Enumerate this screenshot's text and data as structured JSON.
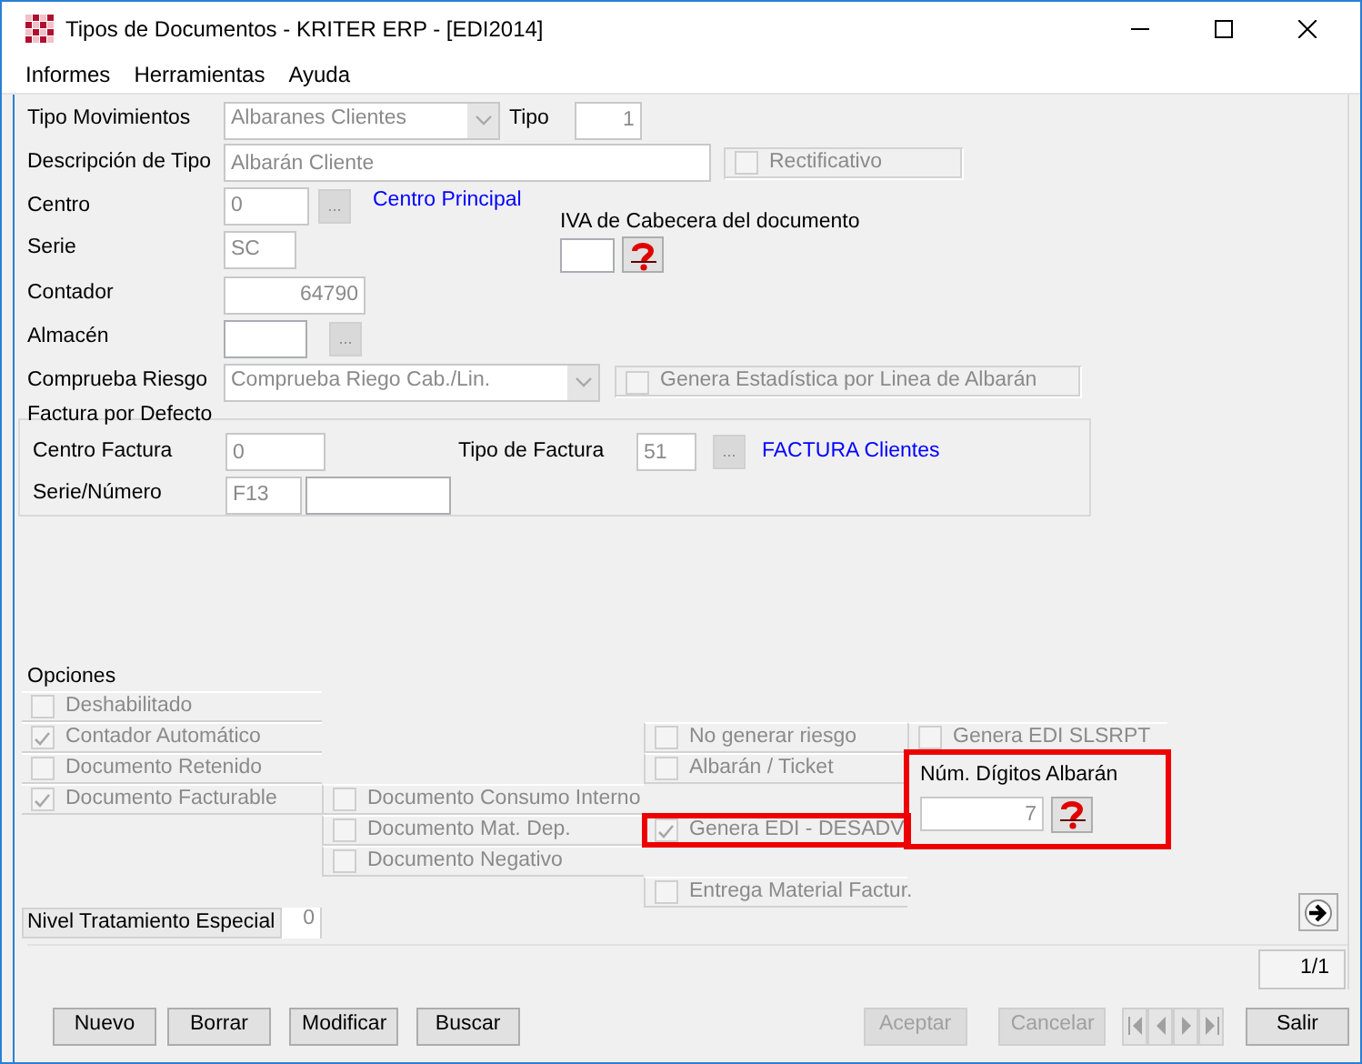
{
  "window": {
    "title": "Tipos de Documentos - KRITER ERP - [EDI2014]"
  },
  "menu": [
    "Informes",
    "Herramientas",
    "Ayuda"
  ],
  "header": {
    "tipo_movimientos": {
      "label": "Tipo Movimientos",
      "value": "Albaranes Clientes",
      "disabled": true
    },
    "tipo": {
      "label": "Tipo",
      "value": "1",
      "disabled": true
    },
    "descripcion": {
      "label": "Descripción de Tipo",
      "value": "Albarán Cliente",
      "disabled": true
    },
    "rectificativo": {
      "label": "Rectificativo",
      "checked": false,
      "disabled": true
    },
    "centro": {
      "label": "Centro",
      "value": "0",
      "disabled": true,
      "button": {
        "label": "...",
        "disabled": true
      },
      "name": "Centro Principal"
    },
    "iva": {
      "label": "IVA de Cabecera del documento",
      "disabled": false
    },
    "serie": {
      "label": "Serie",
      "value": "SC",
      "disabled": true
    },
    "contador": {
      "label": "Contador",
      "value": "64790",
      "disabled": true
    },
    "almacen": {
      "label": "Almacén",
      "disabled": false,
      "button": {
        "label": "...",
        "disabled": true
      }
    },
    "comprueba_riesgo": {
      "label": "Comprueba Riesgo",
      "value": "Comprueba Riego Cab./Lin.",
      "disabled": true
    },
    "genera_estadistica": {
      "label": "Genera Estadística por Linea de Albarán",
      "checked": false,
      "disabled": true
    }
  },
  "factura_por_defecto": {
    "title": "Factura por Defecto",
    "centro_factura": {
      "label": "Centro Factura",
      "value": "0",
      "disabled": true
    },
    "tipo_factura": {
      "label": "Tipo de Factura",
      "value": "51",
      "disabled": true,
      "button": {
        "label": "...",
        "disabled": true
      },
      "name": "FACTURA Clientes"
    },
    "serie_numero": {
      "label": "Serie/Número",
      "value": "F13",
      "disabled": true
    }
  },
  "opciones": {
    "title": "Opciones",
    "checkboxes": [
      {
        "label": "Deshabilitado",
        "checked": false,
        "disabled": true,
        "highlighted": false
      },
      {
        "label": "Contador Automático",
        "checked": true,
        "disabled": true,
        "highlighted": false
      },
      {
        "label": "Documento Retenido",
        "checked": false,
        "disabled": true,
        "highlighted": false
      },
      {
        "label": "Documento Facturable",
        "checked": true,
        "disabled": true,
        "highlighted": false
      },
      {
        "label": "Documento Consumo Interno",
        "checked": false,
        "disabled": true,
        "highlighted": false
      },
      {
        "label": "Documento Mat. Dep.",
        "checked": false,
        "disabled": true,
        "highlighted": false
      },
      {
        "label": "Documento Negativo",
        "checked": false,
        "disabled": true,
        "highlighted": false
      },
      {
        "label": "No generar riesgo",
        "checked": false,
        "disabled": true,
        "highlighted": false
      },
      {
        "label": "Albarán / Ticket",
        "checked": false,
        "disabled": true,
        "highlighted": false
      },
      {
        "label": "Genera EDI - DESADV",
        "checked": true,
        "disabled": true,
        "highlighted": true
      },
      {
        "label": "Entrega Material Factur.",
        "checked": false,
        "disabled": true,
        "highlighted": false
      },
      {
        "label": "Genera EDI SLSRPT",
        "checked": false,
        "disabled": true,
        "highlighted": false
      }
    ],
    "digitos_albaran": {
      "label": "Núm. Dígitos Albarán",
      "value": "7",
      "disabled": true,
      "highlighted": true
    },
    "nivel_tratamiento": {
      "label": "Nivel Tratamiento Especial",
      "value": "0",
      "disabled": true
    }
  },
  "record_indicator": "1/1",
  "buttons": [
    {
      "label": "Nuevo",
      "disabled": false
    },
    {
      "label": "Borrar",
      "disabled": false
    },
    {
      "label": "Modificar",
      "disabled": false
    },
    {
      "label": "Buscar",
      "disabled": false
    },
    {
      "label": "Aceptar",
      "disabled": true
    },
    {
      "label": "Cancelar",
      "disabled": true
    }
  ],
  "nav_buttons": [
    {
      "kind": "first",
      "disabled": true
    },
    {
      "kind": "previous",
      "disabled": true
    },
    {
      "kind": "next",
      "disabled": true
    },
    {
      "kind": "last",
      "disabled": true
    }
  ],
  "exit_button": {
    "label": "Salir",
    "disabled": false
  }
}
